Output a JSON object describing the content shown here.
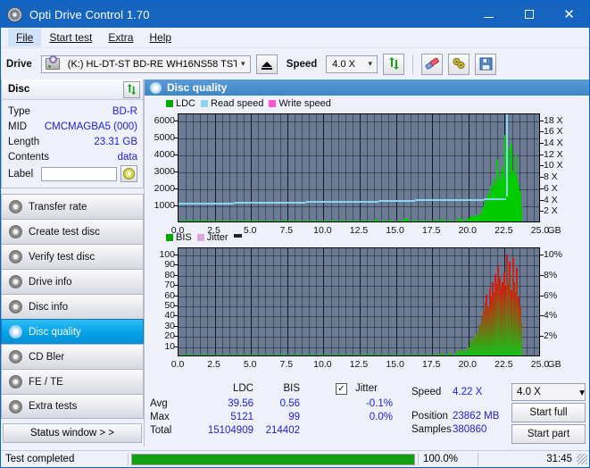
{
  "window": {
    "title": "Opti Drive Control 1.70",
    "icon": "disc-icon",
    "minimize": "–",
    "maximize": "□",
    "close": "✕"
  },
  "menu": [
    {
      "label": "File",
      "selected": true
    },
    {
      "label": "Start test",
      "selected": false
    },
    {
      "label": "Extra",
      "selected": false
    },
    {
      "label": "Help",
      "selected": false
    }
  ],
  "toolbar": {
    "drive_label": "Drive",
    "drive_value": "(K:)  HL-DT-ST BD-RE  WH16NS58 TST4",
    "eject_icon": "eject-icon",
    "speed_label": "Speed",
    "speed_value": "4.0 X",
    "refresh_icon": "refresh-icon",
    "eraser_icon": "eraser-icon",
    "tools_icon": "tools-icon",
    "save_icon": "save-icon"
  },
  "disc_panel": {
    "header": "Disc",
    "refresh_icon": "refresh-icon",
    "rows": [
      {
        "key": "Type",
        "value": "BD-R"
      },
      {
        "key": "MID",
        "value": "CMCMAGBA5 (000)"
      },
      {
        "key": "Length",
        "value": "23.31 GB"
      },
      {
        "key": "Contents",
        "value": "data"
      }
    ],
    "label_key": "Label",
    "label_value": "",
    "label_placeholder": "",
    "disc_icon": "cd-icon"
  },
  "sidebar": {
    "items": [
      {
        "label": "Transfer rate",
        "active": false
      },
      {
        "label": "Create test disc",
        "active": false
      },
      {
        "label": "Verify test disc",
        "active": false
      },
      {
        "label": "Drive info",
        "active": false
      },
      {
        "label": "Disc info",
        "active": false
      },
      {
        "label": "Disc quality",
        "active": true
      },
      {
        "label": "CD Bler",
        "active": false
      },
      {
        "label": "FE / TE",
        "active": false
      },
      {
        "label": "Extra tests",
        "active": false
      }
    ],
    "status_window": "Status window > >"
  },
  "main": {
    "header_title": "Disc quality",
    "header_icon": "disc-quality-icon"
  },
  "chart_data": [
    {
      "type": "bar",
      "id": "ldc-chart",
      "title": "",
      "legend": [
        {
          "label": "LDC",
          "color": "#00a800"
        },
        {
          "label": "Read speed",
          "color": "#8ad4f2"
        },
        {
          "label": "Write speed",
          "color": "#ff55cc"
        }
      ],
      "xlabel": "GB",
      "xticks": [
        "0.0",
        "2.5",
        "5.0",
        "7.5",
        "10.0",
        "12.5",
        "15.0",
        "17.5",
        "20.0",
        "22.5",
        "25.0"
      ],
      "xlim": [
        0,
        25
      ],
      "ylabel_left": "",
      "yticks_left": [
        1000,
        2000,
        3000,
        4000,
        5000,
        6000
      ],
      "ylim_left": [
        0,
        6400
      ],
      "yticks_right": [
        "2 X",
        "4 X",
        "6 X",
        "8 X",
        "10 X",
        "12 X",
        "14 X",
        "16 X",
        "18 X"
      ],
      "ylim_right": [
        0,
        19.2
      ],
      "grid": true,
      "series": [
        {
          "name": "LDC",
          "color": "#00cc00",
          "x": [
            0.1,
            0.4,
            0.8,
            1.2,
            1.6,
            2.0,
            2.5,
            3.0,
            3.5,
            4.0,
            4.5,
            5.0,
            5.5,
            6.0,
            6.5,
            7.0,
            7.5,
            8.0,
            8.5,
            9.0,
            9.5,
            10.0,
            10.5,
            11.0,
            11.5,
            12.0,
            12.5,
            13.0,
            13.5,
            14.0,
            14.5,
            15.0,
            15.5,
            16.0,
            16.5,
            17.0,
            17.5,
            18.0,
            18.5,
            19.0,
            19.3,
            19.6,
            19.9,
            20.1,
            20.3,
            20.5,
            20.7,
            20.9,
            21.0,
            21.1,
            21.2,
            21.3,
            21.4,
            21.5,
            21.6,
            21.7,
            21.8,
            21.9,
            22.0,
            22.1,
            22.2,
            22.3,
            22.4,
            22.5,
            22.6,
            22.7,
            22.8,
            22.9,
            23.0,
            23.1,
            23.2,
            23.3,
            23.4,
            23.5,
            23.6
          ],
          "values": [
            40,
            35,
            30,
            32,
            30,
            28,
            30,
            32,
            30,
            28,
            30,
            33,
            30,
            28,
            30,
            32,
            35,
            30,
            28,
            30,
            33,
            30,
            28,
            30,
            60,
            30,
            28,
            30,
            120,
            32,
            30,
            28,
            160,
            35,
            30,
            28,
            30,
            90,
            30,
            28,
            140,
            60,
            180,
            300,
            260,
            420,
            380,
            700,
            900,
            1300,
            1100,
            1700,
            1500,
            2100,
            1800,
            2500,
            2200,
            3600,
            2900,
            2400,
            2800,
            3200,
            2600,
            5100,
            3000,
            4300,
            2800,
            4600,
            3000,
            2700,
            3900,
            2600,
            2200,
            1800,
            900
          ]
        },
        {
          "name": "Read speed",
          "color": "#8ad4f2",
          "x": [
            0.0,
            2.5,
            5.0,
            7.5,
            10.0,
            12.5,
            15.0,
            17.5,
            20.0,
            22.0,
            22.6,
            22.6
          ],
          "values": [
            3.55,
            3.6,
            3.7,
            3.8,
            3.9,
            4.0,
            4.1,
            4.2,
            4.3,
            4.35,
            4.35,
            18.9
          ]
        }
      ]
    },
    {
      "type": "bar",
      "id": "bis-chart",
      "title": "",
      "legend": [
        {
          "label": "BIS",
          "color": "#00a800"
        },
        {
          "label": "Jitter",
          "color": "#d9a8dd"
        }
      ],
      "xlabel": "GB",
      "xticks": [
        "0.0",
        "2.5",
        "5.0",
        "7.5",
        "10.0",
        "12.5",
        "15.0",
        "17.5",
        "20.0",
        "22.5",
        "25.0"
      ],
      "xlim": [
        0,
        25
      ],
      "yticks_left": [
        10,
        20,
        30,
        40,
        50,
        60,
        70,
        80,
        90,
        100
      ],
      "ylim_left": [
        0,
        107
      ],
      "yticks_right": [
        "2%",
        "4%",
        "6%",
        "8%",
        "10%"
      ],
      "ylim_right": [
        0,
        10.7
      ],
      "grid": true,
      "series": [
        {
          "name": "BIS",
          "color": "gradient-green-red",
          "x": [
            0.1,
            0.5,
            1.0,
            1.5,
            2.0,
            2.5,
            3.0,
            3.5,
            4.0,
            4.5,
            5.0,
            5.5,
            6.0,
            6.5,
            7.0,
            7.5,
            8.0,
            8.5,
            9.0,
            9.5,
            10.0,
            10.5,
            11.0,
            11.5,
            12.0,
            12.5,
            13.0,
            13.5,
            14.0,
            14.5,
            15.0,
            15.5,
            16.0,
            16.5,
            17.0,
            17.5,
            18.0,
            18.5,
            19.0,
            19.3,
            19.6,
            19.9,
            20.1,
            20.3,
            20.5,
            20.7,
            20.9,
            21.0,
            21.1,
            21.2,
            21.3,
            21.4,
            21.5,
            21.6,
            21.7,
            21.8,
            21.9,
            22.0,
            22.1,
            22.2,
            22.3,
            22.4,
            22.5,
            22.6,
            22.7,
            22.8,
            22.9,
            23.0,
            23.1,
            23.2,
            23.3,
            23.4,
            23.5,
            23.6
          ],
          "values": [
            1,
            1,
            1,
            1,
            1,
            1,
            1,
            1,
            1,
            1,
            1,
            1,
            1,
            1,
            1,
            1,
            1,
            1,
            1,
            1,
            1,
            1,
            1,
            1,
            1,
            1,
            1,
            1,
            1,
            1,
            1,
            1,
            1,
            1,
            1,
            1,
            2,
            2,
            3,
            5,
            4,
            8,
            14,
            18,
            22,
            30,
            38,
            44,
            52,
            60,
            48,
            66,
            58,
            72,
            62,
            80,
            70,
            88,
            76,
            66,
            72,
            82,
            68,
            99,
            70,
            92,
            64,
            96,
            72,
            62,
            86,
            58,
            48,
            32
          ]
        }
      ]
    }
  ],
  "stats": {
    "columns": [
      "LDC",
      "BIS"
    ],
    "jitter_label": "Jitter",
    "jitter_checked": true,
    "rows": [
      {
        "label": "Avg",
        "ldc": "39.56",
        "bis": "0.56",
        "jitter": "-0.1%"
      },
      {
        "label": "Max",
        "ldc": "5121",
        "bis": "99",
        "jitter": "0.0%"
      },
      {
        "label": "Total",
        "ldc": "15104909",
        "bis": "214402",
        "jitter": ""
      }
    ]
  },
  "right_panel": {
    "speed_label": "Speed",
    "speed_value": "4.22 X",
    "speed_select": "4.0 X",
    "position_label": "Position",
    "position_value": "23862 MB",
    "samples_label": "Samples",
    "samples_value": "380860",
    "start_full": "Start full",
    "start_part": "Start part"
  },
  "statusbar": {
    "message": "Test completed",
    "percent": "100.0%",
    "progress": 100,
    "time": "31:45"
  }
}
